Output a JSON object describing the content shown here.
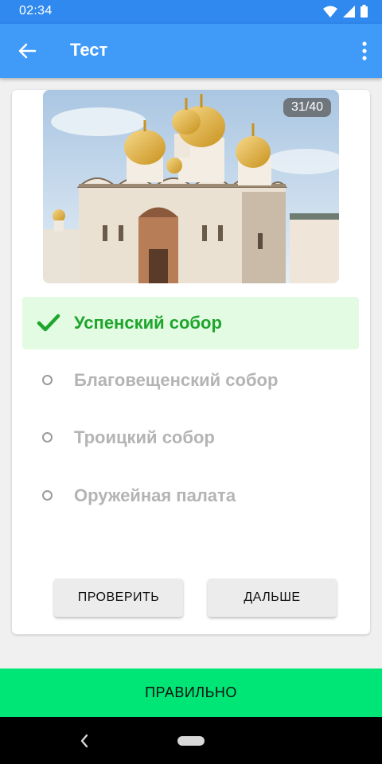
{
  "status": {
    "time": "02:34"
  },
  "appbar": {
    "title": "Тест"
  },
  "quiz": {
    "counter": "31/40",
    "options": [
      {
        "label": "Успенский собор",
        "state": "correct"
      },
      {
        "label": "Благовещенский собор",
        "state": "unselected"
      },
      {
        "label": "Троицкий собор",
        "state": "unselected"
      },
      {
        "label": "Оружейная палата",
        "state": "unselected"
      }
    ],
    "check_label": "ПРОВЕРИТЬ",
    "next_label": "ДАЛЬШЕ"
  },
  "result": {
    "label": "ПРАВИЛЬНО"
  },
  "colors": {
    "accent": "#3f9af8",
    "statusbar": "#2f89ee",
    "correct_green": "#1ea52c",
    "result_green": "#00e676"
  },
  "icons": [
    "wifi-icon",
    "signal-icon",
    "battery-icon",
    "back-arrow-icon",
    "more-vert-icon",
    "checkmark-icon",
    "nav-back-icon",
    "nav-home-icon"
  ]
}
